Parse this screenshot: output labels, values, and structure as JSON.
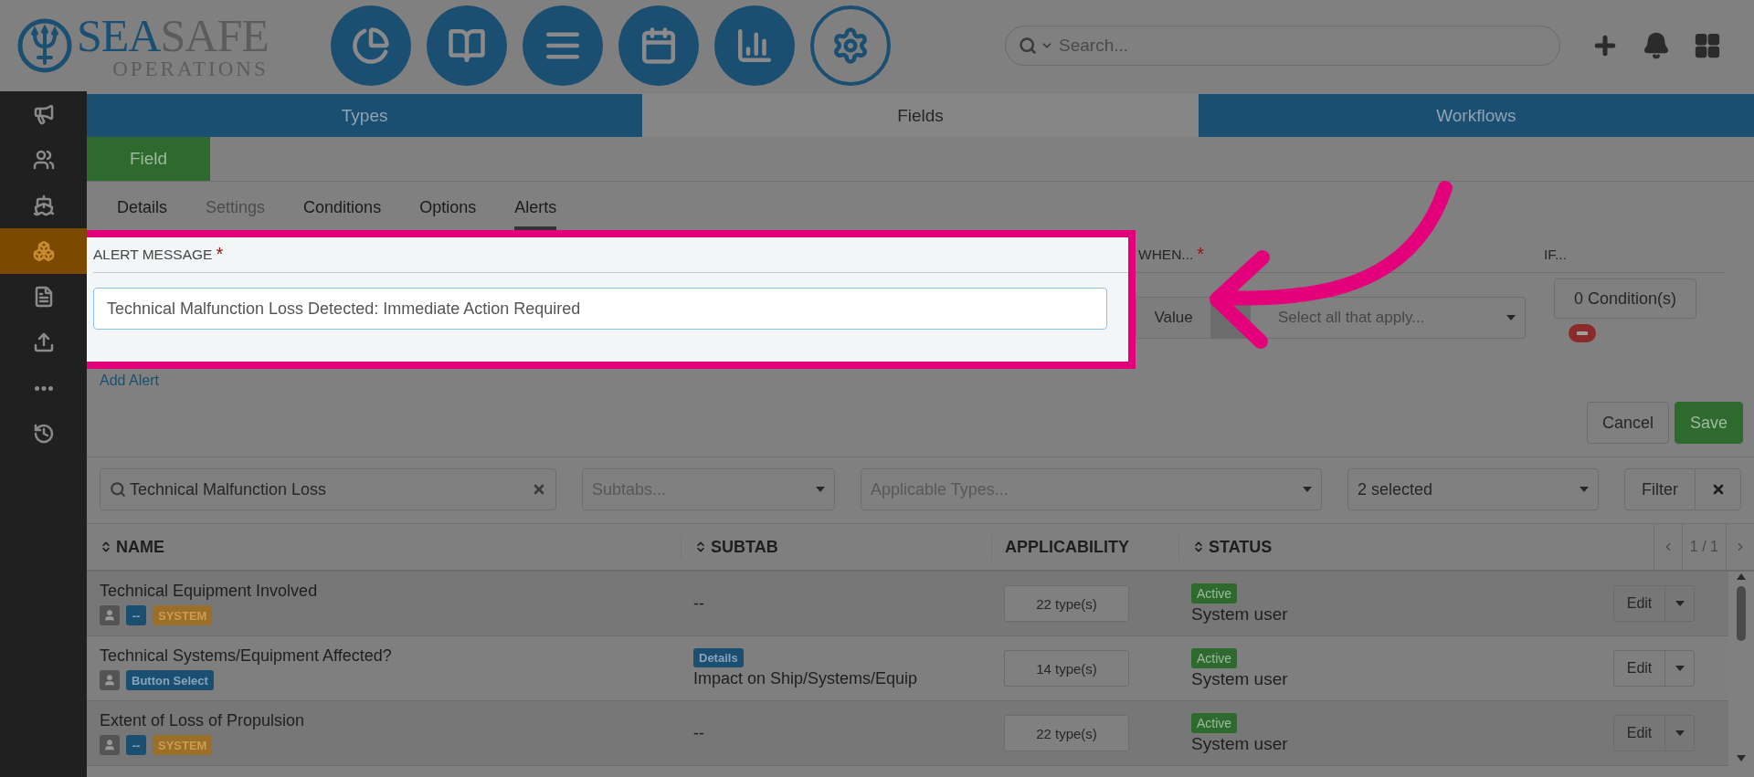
{
  "header": {
    "logo": {
      "primary": "SEA",
      "secondary": "SAFE",
      "tagline": "OPERATIONS"
    },
    "nav_buttons": [
      {
        "selected": false
      },
      {
        "selected": false
      },
      {
        "selected": false
      },
      {
        "selected": false
      },
      {
        "selected": false
      },
      {
        "selected": true
      }
    ],
    "search": {
      "placeholder": "Search..."
    }
  },
  "sidebar": {
    "items": [
      {
        "selected": false
      },
      {
        "selected": false
      },
      {
        "selected": false
      },
      {
        "selected": true
      },
      {
        "selected": false
      },
      {
        "selected": false
      },
      {
        "selected": false
      },
      {
        "selected": false
      }
    ]
  },
  "tabs": [
    {
      "label": "Types",
      "selected": false
    },
    {
      "label": "Fields",
      "selected": true
    },
    {
      "label": "Workflows",
      "selected": false
    }
  ],
  "field_button": "Field",
  "subtabs": [
    {
      "label": "Details",
      "selected": false,
      "disabled": false
    },
    {
      "label": "Settings",
      "selected": false,
      "disabled": true
    },
    {
      "label": "Conditions",
      "selected": false,
      "disabled": false
    },
    {
      "label": "Options",
      "selected": false,
      "disabled": false
    },
    {
      "label": "Alerts",
      "selected": true,
      "disabled": false
    }
  ],
  "alert": {
    "message_label": {
      "text": "ALERT MESSAGE",
      "marker": "*"
    },
    "message_value": "Technical Malfunction Loss Detected: Immediate Action Required",
    "when_label": {
      "text": "WHEN...",
      "marker": "*"
    },
    "when_button": "Value",
    "when_placeholder": "Select all that apply...",
    "if_label": "IF...",
    "conditions_button": "0 Condition(s)",
    "add_link": "Add Alert"
  },
  "actions": [
    {
      "label": "Cancel",
      "kind": "default"
    },
    {
      "label": "Save",
      "kind": "primary"
    }
  ],
  "filters": {
    "search_value": "Technical Malfunction Loss",
    "subtabs_placeholder": "Subtabs...",
    "types_placeholder": "Applicable Types...",
    "status_value": "2 selected",
    "filter_button": "Filter"
  },
  "table": {
    "columns": [
      {
        "label": "NAME",
        "sortable": true
      },
      {
        "label": "SUBTAB",
        "sortable": true
      },
      {
        "label": "APPLICABILITY",
        "sortable": false
      },
      {
        "label": "STATUS",
        "sortable": true
      }
    ],
    "page": "1 / 1",
    "rows": [
      {
        "name": "Technical Equipment Involved",
        "tags": [
          {
            "kind": "user"
          },
          {
            "kind": "type",
            "text": "--"
          },
          {
            "kind": "system",
            "text": "SYSTEM"
          }
        ],
        "subtab": {
          "text": "--"
        },
        "applicability": "22 type(s)",
        "status": "Active",
        "status_by": "System user",
        "edit": "Edit"
      },
      {
        "name": "Technical Systems/Equipment Affected?",
        "tags": [
          {
            "kind": "user"
          },
          {
            "kind": "type",
            "text": "Button Select"
          }
        ],
        "subtab": {
          "tag": "Details",
          "text": "Impact on Ship/Systems/Equip"
        },
        "applicability": "14 type(s)",
        "status": "Active",
        "status_by": "System user",
        "edit": "Edit"
      },
      {
        "name": "Extent of Loss of Propulsion",
        "tags": [
          {
            "kind": "user"
          },
          {
            "kind": "type",
            "text": "--"
          },
          {
            "kind": "system",
            "text": "SYSTEM"
          }
        ],
        "subtab": {
          "text": "--"
        },
        "applicability": "22 type(s)",
        "status": "Active",
        "status_by": "System user",
        "edit": "Edit"
      }
    ]
  }
}
